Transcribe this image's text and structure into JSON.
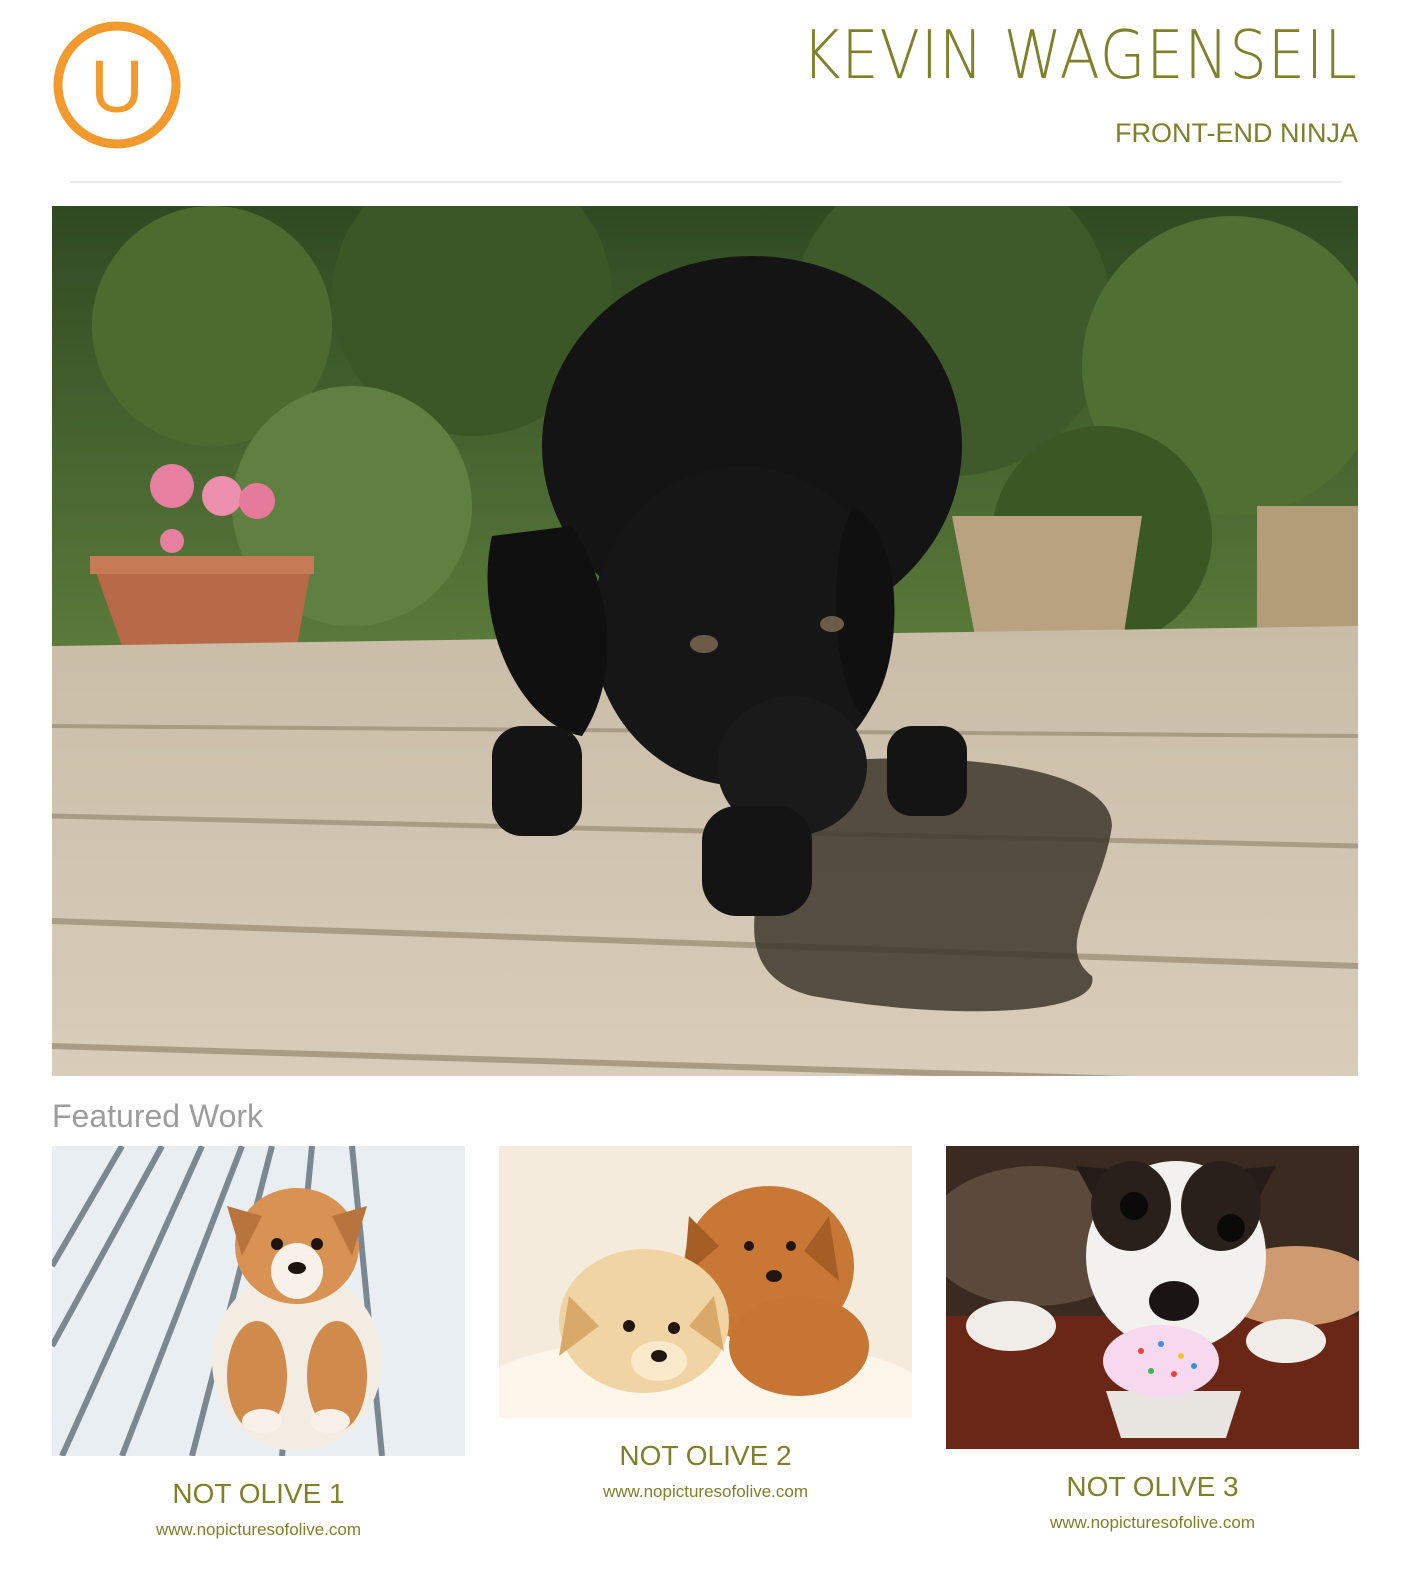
{
  "header": {
    "logo_letter": "U",
    "name": "KEVIN WAGENSEIL",
    "tagline": "FRONT-END NINJA"
  },
  "colors": {
    "accent": "#f29a2e",
    "text_olive": "#7f8029",
    "section_gray": "#9d9d9d"
  },
  "hero": {
    "image": "black-labrador-puppy-on-deck-photo"
  },
  "featured": {
    "title": "Featured Work",
    "items": [
      {
        "title": "NOT OLIVE 1",
        "link": "www.nopicturesofolive.com",
        "image": "corgi-puppy-on-white-deck-photo"
      },
      {
        "title": "NOT OLIVE 2",
        "link": "www.nopicturesofolive.com",
        "image": "two-puppies-on-fur-photo"
      },
      {
        "title": "NOT OLIVE 3",
        "link": "www.nopicturesofolive.com",
        "image": "terrier-puppy-with-cupcake-photo"
      }
    ]
  }
}
